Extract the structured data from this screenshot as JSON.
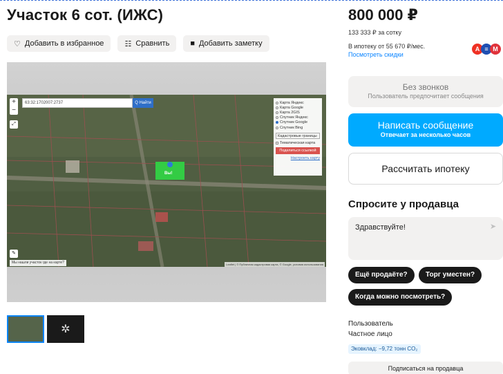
{
  "listing": {
    "title": "Участок 6 сот. (ИЖС)",
    "price": "800 000 ₽",
    "price_per_unit": "133 333 ₽ за сотку",
    "mortgage_text": "В ипотеку от 55 670 ₽/мес.",
    "discounts_link": "Посмотреть скидки"
  },
  "actions": {
    "favorite_label": "Добавить в избранное",
    "compare_label": "Сравнить",
    "note_label": "Добавить заметку"
  },
  "map": {
    "search_value": "63:32:1702007:2737",
    "find_label": "Q Найти",
    "zoom_in": "+",
    "zoom_out": "−",
    "layers": [
      "Карта Яндекс",
      "Карта Google",
      "Карта 2GIS",
      "Спутник Яндекс",
      "Спутник Google",
      "Спутник Bing"
    ],
    "layer_selected": "Спутник Google",
    "boundaries_select": "Кадастровые границы",
    "thematic_label": "Тематическая карта",
    "share_label": "Поделиться ссылкой",
    "setup_label": "Настроить карту",
    "tooltip": "Мы нашли участок где на карте?",
    "attribution": "Leaflet | © Публичная кадастровая карта, © Google, условия использования",
    "marker_label": "Вы!"
  },
  "banks": [
    {
      "letter": "А",
      "color": "#ef3124"
    },
    {
      "letter": "≡",
      "color": "#1f4fb2"
    },
    {
      "letter": "М",
      "color": "#e0333b"
    }
  ],
  "contact": {
    "no_calls_title": "Без звонков",
    "no_calls_sub": "Пользователь предпочитает сообщения",
    "write_title": "Написать сообщение",
    "write_sub": "Отвечает за несколько часов",
    "mortgage_btn": "Рассчитать ипотеку"
  },
  "ask": {
    "heading": "Спросите у продавца",
    "message": "Здравствуйте!",
    "chips": [
      "Ещё продаёте?",
      "Торг уместен?",
      "Когда можно посмотреть?"
    ]
  },
  "seller": {
    "name": "Пользователь",
    "type": "Частное лицо",
    "eco": "Эковклад: −9,72 тонн CO₂",
    "subscribe": "Подписаться на продавца"
  }
}
